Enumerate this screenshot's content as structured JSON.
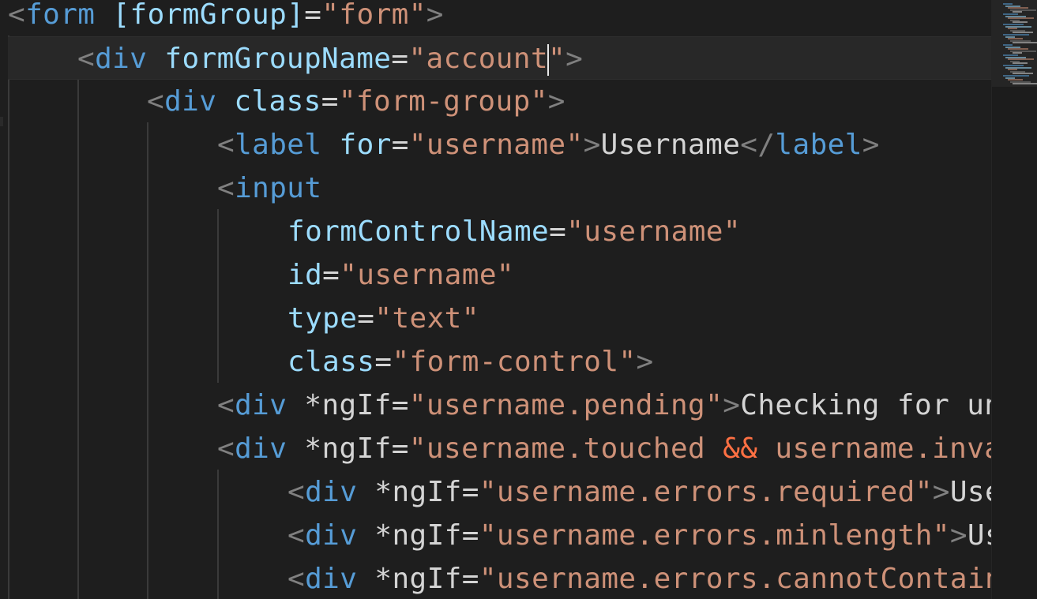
{
  "editor": {
    "lines": [
      {
        "name": "code-line-1",
        "tokens": [
          {
            "t": "<",
            "c": "punc"
          },
          {
            "t": "form",
            "c": "tag"
          },
          {
            "t": " ",
            "c": "txt"
          },
          {
            "t": "[formGroup]",
            "c": "attr"
          },
          {
            "t": "=",
            "c": "txt"
          },
          {
            "t": "\"form\"",
            "c": "str"
          },
          {
            "t": ">",
            "c": "punc"
          }
        ]
      },
      {
        "name": "code-line-2",
        "tokens": [
          {
            "t": "<",
            "c": "punc"
          },
          {
            "t": "div",
            "c": "tag"
          },
          {
            "t": " ",
            "c": "txt"
          },
          {
            "t": "formGroupName",
            "c": "attr"
          },
          {
            "t": "=",
            "c": "txt"
          },
          {
            "t": "\"account",
            "c": "str"
          },
          {
            "t": "|",
            "c": "cursor"
          },
          {
            "t": "\"",
            "c": "str"
          },
          {
            "t": ">",
            "c": "punc"
          }
        ]
      },
      {
        "name": "code-line-3",
        "tokens": [
          {
            "t": "<",
            "c": "punc"
          },
          {
            "t": "div",
            "c": "tag"
          },
          {
            "t": " ",
            "c": "txt"
          },
          {
            "t": "class",
            "c": "attr"
          },
          {
            "t": "=",
            "c": "txt"
          },
          {
            "t": "\"form-group\"",
            "c": "str"
          },
          {
            "t": ">",
            "c": "punc"
          }
        ]
      },
      {
        "name": "code-line-4",
        "tokens": [
          {
            "t": "<",
            "c": "punc"
          },
          {
            "t": "label",
            "c": "tag"
          },
          {
            "t": " ",
            "c": "txt"
          },
          {
            "t": "for",
            "c": "attr"
          },
          {
            "t": "=",
            "c": "txt"
          },
          {
            "t": "\"username\"",
            "c": "str"
          },
          {
            "t": ">",
            "c": "punc"
          },
          {
            "t": "Username",
            "c": "txt"
          },
          {
            "t": "</",
            "c": "punc"
          },
          {
            "t": "label",
            "c": "tag"
          },
          {
            "t": ">",
            "c": "punc"
          }
        ]
      },
      {
        "name": "code-line-5",
        "tokens": [
          {
            "t": "<",
            "c": "punc"
          },
          {
            "t": "input",
            "c": "tag"
          }
        ]
      },
      {
        "name": "code-line-6",
        "tokens": [
          {
            "t": "formControlName",
            "c": "attr"
          },
          {
            "t": "=",
            "c": "txt"
          },
          {
            "t": "\"username\"",
            "c": "str"
          }
        ]
      },
      {
        "name": "code-line-7",
        "tokens": [
          {
            "t": "id",
            "c": "attr"
          },
          {
            "t": "=",
            "c": "txt"
          },
          {
            "t": "\"username\"",
            "c": "str"
          }
        ]
      },
      {
        "name": "code-line-8",
        "tokens": [
          {
            "t": "type",
            "c": "attr"
          },
          {
            "t": "=",
            "c": "txt"
          },
          {
            "t": "\"text\"",
            "c": "str"
          }
        ]
      },
      {
        "name": "code-line-9",
        "tokens": [
          {
            "t": "class",
            "c": "attr"
          },
          {
            "t": "=",
            "c": "txt"
          },
          {
            "t": "\"form-control\"",
            "c": "str"
          },
          {
            "t": ">",
            "c": "punc"
          }
        ]
      },
      {
        "name": "code-line-10",
        "tokens": [
          {
            "t": "<",
            "c": "punc"
          },
          {
            "t": "div",
            "c": "tag"
          },
          {
            "t": " ",
            "c": "txt"
          },
          {
            "t": "*ngIf",
            "c": "ng"
          },
          {
            "t": "=",
            "c": "txt"
          },
          {
            "t": "\"username.pending\"",
            "c": "str"
          },
          {
            "t": ">",
            "c": "punc"
          },
          {
            "t": "Checking for un",
            "c": "txt"
          }
        ]
      },
      {
        "name": "code-line-11",
        "tokens": [
          {
            "t": "<",
            "c": "punc"
          },
          {
            "t": "div",
            "c": "tag"
          },
          {
            "t": " ",
            "c": "txt"
          },
          {
            "t": "*ngIf",
            "c": "ng"
          },
          {
            "t": "=",
            "c": "txt"
          },
          {
            "t": "\"username.touched ",
            "c": "str"
          },
          {
            "t": "&&",
            "c": "amp"
          },
          {
            "t": " username.inva",
            "c": "str"
          }
        ]
      },
      {
        "name": "code-line-12",
        "tokens": [
          {
            "t": "<",
            "c": "punc"
          },
          {
            "t": "div",
            "c": "tag"
          },
          {
            "t": " ",
            "c": "txt"
          },
          {
            "t": "*ngIf",
            "c": "ng"
          },
          {
            "t": "=",
            "c": "txt"
          },
          {
            "t": "\"username.errors.required\"",
            "c": "str"
          },
          {
            "t": ">",
            "c": "punc"
          },
          {
            "t": "Use",
            "c": "txt"
          }
        ]
      },
      {
        "name": "code-line-13",
        "tokens": [
          {
            "t": "<",
            "c": "punc"
          },
          {
            "t": "div",
            "c": "tag"
          },
          {
            "t": " ",
            "c": "txt"
          },
          {
            "t": "*ngIf",
            "c": "ng"
          },
          {
            "t": "=",
            "c": "txt"
          },
          {
            "t": "\"username.errors.minlength\"",
            "c": "str"
          },
          {
            "t": ">",
            "c": "punc"
          },
          {
            "t": "Us",
            "c": "txt"
          }
        ]
      },
      {
        "name": "code-line-14",
        "tokens": [
          {
            "t": "<",
            "c": "punc"
          },
          {
            "t": "div",
            "c": "tag"
          },
          {
            "t": " ",
            "c": "txt"
          },
          {
            "t": "*ngIf",
            "c": "ng"
          },
          {
            "t": "=",
            "c": "txt"
          },
          {
            "t": "\"username.errors.cannotContain",
            "c": "str"
          }
        ]
      }
    ]
  },
  "colors": {
    "background": "#1e1e1e",
    "tag": "#569cd6",
    "attribute": "#9cdcfe",
    "string": "#ce9178",
    "text": "#d4d4d4",
    "punctuation": "#808080",
    "operator": "#ff7043"
  }
}
